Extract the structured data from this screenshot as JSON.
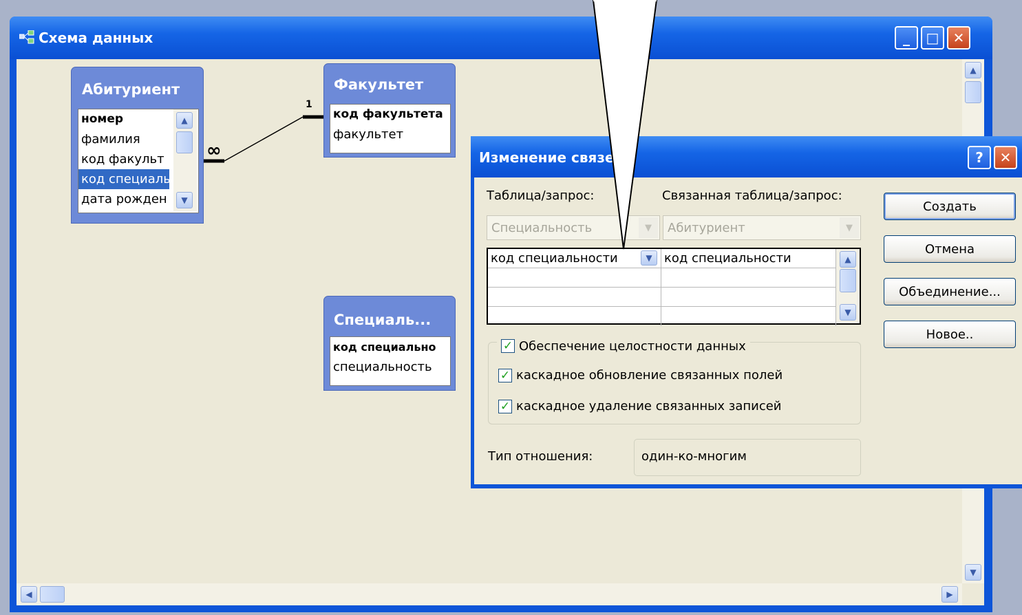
{
  "main_window": {
    "title": "Схема данных",
    "minimize": "_",
    "maximize": "□",
    "close": "✕"
  },
  "tables": {
    "abiturient": {
      "title": "Абитуриент",
      "fields": [
        "номер",
        "фамилия",
        "код факульт",
        "код специаль",
        "дата рожден"
      ]
    },
    "fakultet": {
      "title": "Факультет",
      "fields": [
        "код факультета",
        "факультет"
      ]
    },
    "specialnost": {
      "title": "Специаль...",
      "fields": [
        "код специально",
        "специальность"
      ]
    }
  },
  "relationship": {
    "one_label": "1",
    "many_label": "∞"
  },
  "dialog": {
    "title": "Изменение связей",
    "table_label": "Таблица/запрос:",
    "related_label": "Связанная таблица/запрос:",
    "table_value": "Специальность",
    "related_value": "Абитуриент",
    "grid_rows": [
      [
        "код специальности",
        "код специальности"
      ],
      [
        "",
        ""
      ],
      [
        "",
        ""
      ],
      [
        "",
        ""
      ]
    ],
    "integrity": "Обеспечение целостности данных",
    "cascade_update": "каскадное обновление связанных полей",
    "cascade_delete": "каскадное удаление связанных записей",
    "relation_type_label": "Тип отношения:",
    "relation_type_value": "один-ко-многим",
    "buttons": {
      "create": "Создать",
      "cancel": "Отмена",
      "join": "Объединение...",
      "new": "Новое.."
    },
    "help": "?",
    "close": "✕"
  }
}
